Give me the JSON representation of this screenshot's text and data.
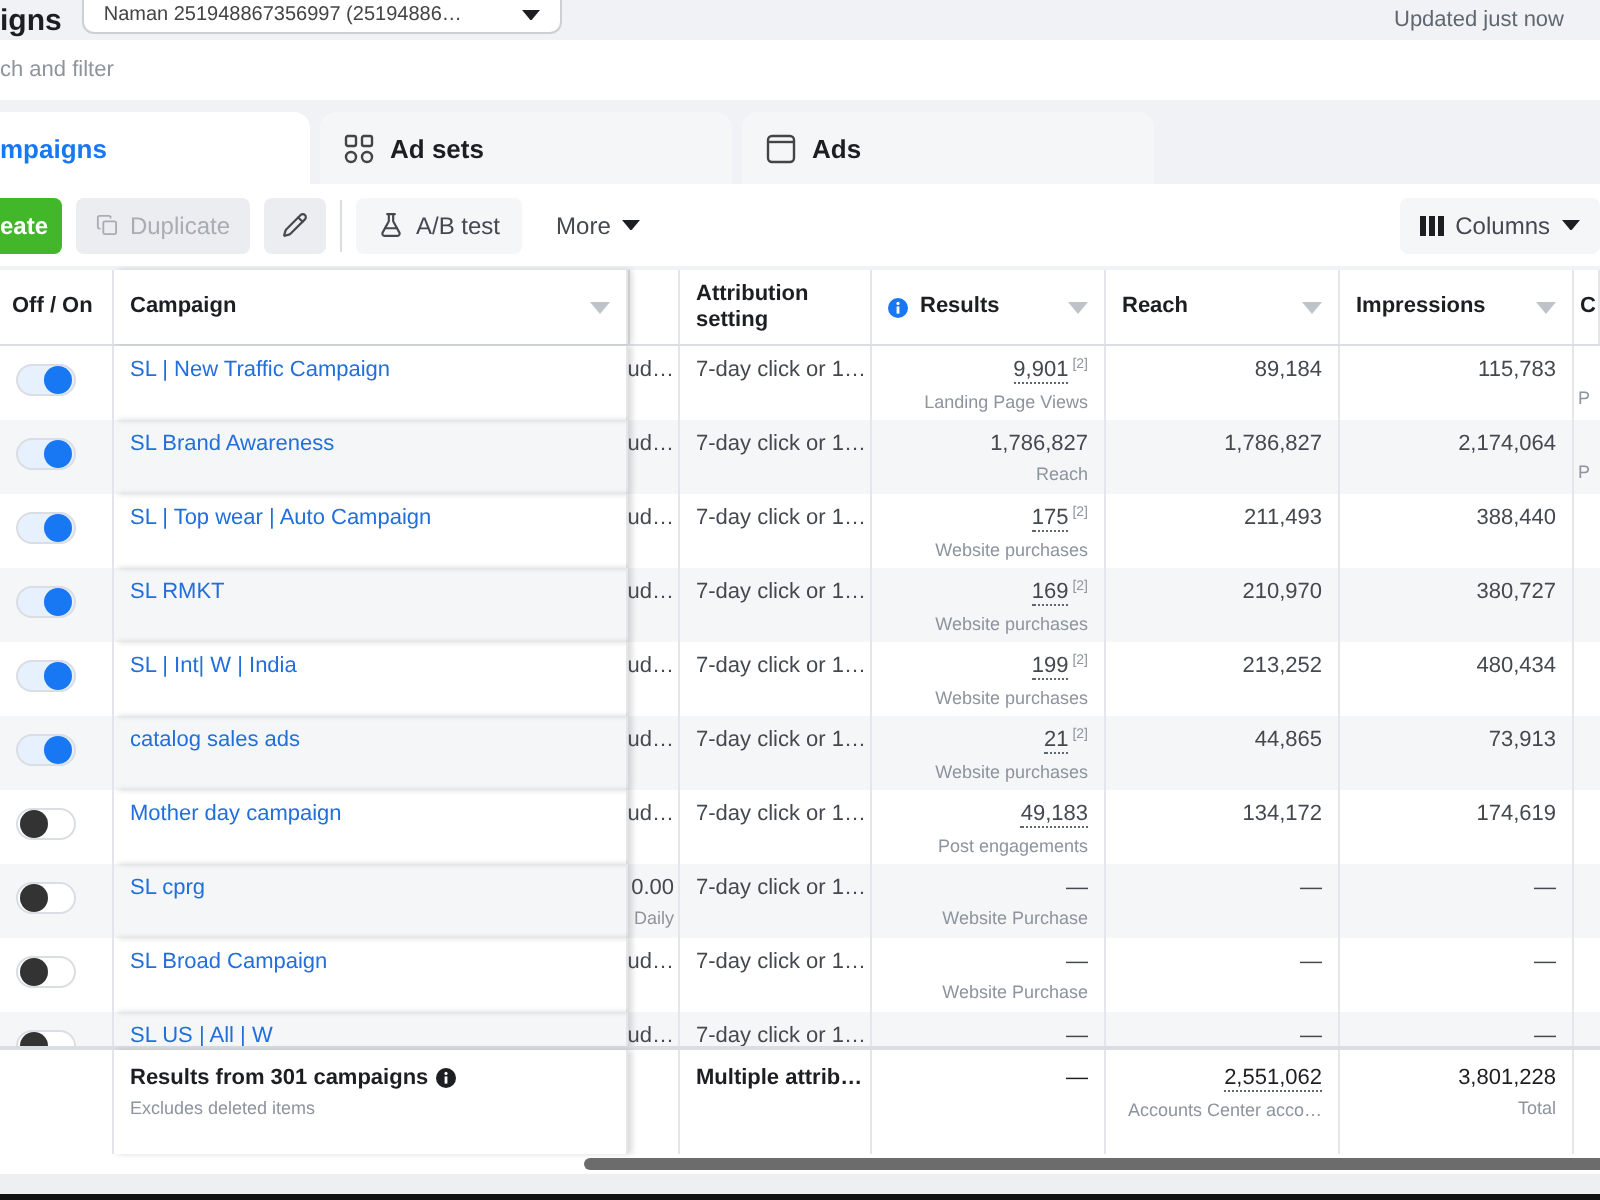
{
  "header": {
    "title": "igns",
    "account": "Naman 251948867356997 (25194886…",
    "status": "Updated just now"
  },
  "search": {
    "placeholder": "ch and filter"
  },
  "tabs": [
    {
      "label": "mpaigns",
      "selected": true,
      "kind": "campaigns"
    },
    {
      "label": "Ad sets",
      "selected": false,
      "kind": "adsets"
    },
    {
      "label": "Ads",
      "selected": false,
      "kind": "ads"
    }
  ],
  "toolbar": {
    "left": [
      {
        "label": "eate",
        "kind": "create",
        "disabled": false
      },
      {
        "label": "Duplicate",
        "kind": "duplicate",
        "disabled": true
      },
      {
        "kind": "edit",
        "disabled": false
      },
      {
        "label": "A/B test",
        "kind": "abtest",
        "disabled": false
      },
      {
        "label": "More",
        "kind": "more",
        "disabled": false
      }
    ],
    "right": {
      "label": "Columns"
    }
  },
  "table": {
    "columns": [
      {
        "label": "Off / On"
      },
      {
        "label": "Campaign",
        "sortable": true
      },
      {
        "label": "Attribution setting"
      },
      {
        "label": "Results",
        "sortable": true,
        "info": true
      },
      {
        "label": "Reach",
        "sortable": true
      },
      {
        "label": "Impressions",
        "sortable": true
      },
      {
        "label": "C"
      }
    ],
    "rows": [
      {
        "on": true,
        "campaign": "SL | New Traffic Campaign",
        "column_3": "ud…",
        "attribution": "7-day click or 1…",
        "results": {
          "value": "9,901",
          "note": "[2]",
          "underlined": true,
          "label": "Landing Page Views"
        },
        "reach": "89,184",
        "impressions": "115,783",
        "column_8": "P"
      },
      {
        "on": true,
        "campaign": "SL Brand Awareness",
        "column_3": "ud…",
        "attribution": "7-day click or 1…",
        "results": {
          "value": "1,786,827",
          "underlined": false,
          "label": "Reach"
        },
        "reach": "1,786,827",
        "impressions": "2,174,064",
        "column_8": "P"
      },
      {
        "on": true,
        "campaign": "SL | Top wear | Auto Campaign",
        "column_3": "ud…",
        "attribution": "7-day click or 1…",
        "results": {
          "value": "175",
          "note": "[2]",
          "underlined": true,
          "label": "Website purchases"
        },
        "reach": "211,493",
        "impressions": "388,440"
      },
      {
        "on": true,
        "campaign": "SL RMKT",
        "column_3": "ud…",
        "attribution": "7-day click or 1…",
        "results": {
          "value": "169",
          "note": "[2]",
          "underlined": true,
          "label": "Website purchases"
        },
        "reach": "210,970",
        "impressions": "380,727"
      },
      {
        "on": true,
        "campaign": "SL | Int| W | India",
        "column_3": "ud…",
        "attribution": "7-day click or 1…",
        "results": {
          "value": "199",
          "note": "[2]",
          "underlined": true,
          "label": "Website purchases"
        },
        "reach": "213,252",
        "impressions": "480,434"
      },
      {
        "on": true,
        "campaign": "catalog sales ads",
        "column_3": "ud…",
        "attribution": "7-day click or 1…",
        "results": {
          "value": "21",
          "note": "[2]",
          "underlined": true,
          "label": "Website purchases"
        },
        "reach": "44,865",
        "impressions": "73,913"
      },
      {
        "on": false,
        "campaign": "Mother day campaign",
        "column_3": "ud…",
        "attribution": "7-day click or 1…",
        "results": {
          "value": "49,183",
          "underlined": true,
          "label": "Post engagements"
        },
        "reach": "134,172",
        "impressions": "174,619"
      },
      {
        "on": false,
        "campaign": "SL cprg",
        "column_3": "0.00",
        "column_3_note": "Daily",
        "attribution": "7-day click or 1…",
        "results": {
          "value": "—",
          "underlined": false,
          "label": "Website Purchase"
        },
        "reach": "—",
        "impressions": "—"
      },
      {
        "on": false,
        "campaign": "SL Broad Campaign",
        "column_3": "ud…",
        "attribution": "7-day click or 1…",
        "results": {
          "value": "—",
          "underlined": false,
          "label": "Website Purchase"
        },
        "reach": "—",
        "impressions": "—"
      },
      {
        "on": false,
        "campaign": "SL US | All | W",
        "column_3": "ud…",
        "attribution": "7-day click or 1…",
        "results": {
          "value": "—",
          "underlined": false
        },
        "reach": "—",
        "impressions": "—"
      }
    ],
    "footer": {
      "title": "Results from 301 campaigns",
      "subtitle": "Excludes deleted items",
      "attribution": "Multiple attrib…",
      "results": "—",
      "reach": "2,551,062",
      "reach_label": "Accounts Center acco…",
      "impressions": "3,801,228",
      "impressions_label": "Total"
    }
  }
}
